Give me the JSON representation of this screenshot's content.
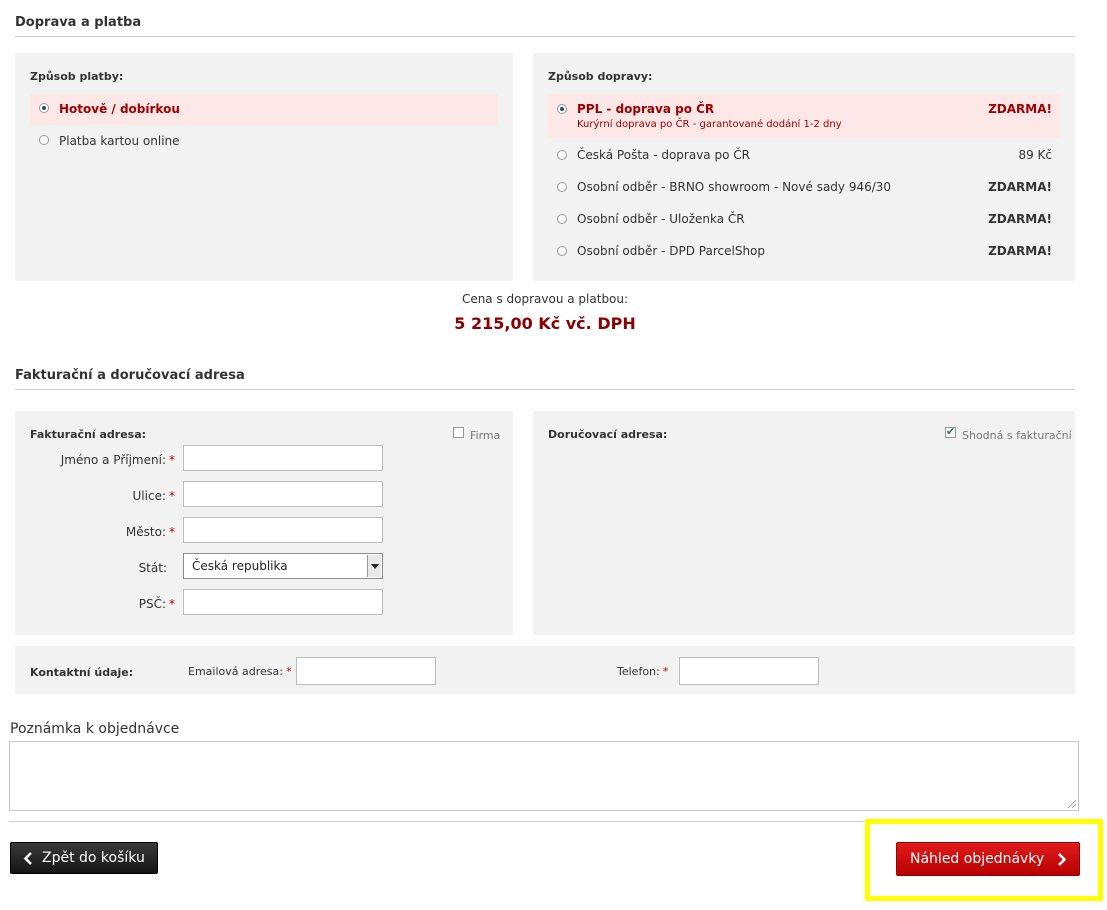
{
  "sections": {
    "shipping_payment_title": "Doprava a platba",
    "address_title": "Fakturační a doručovací adresa"
  },
  "payment": {
    "heading": "Způsob platby:",
    "options": [
      {
        "label": "Hotově / dobírkou",
        "selected": true
      },
      {
        "label": "Platba kartou online",
        "selected": false
      }
    ]
  },
  "shipping": {
    "heading": "Způsob dopravy:",
    "options": [
      {
        "label": "PPL - doprava po ČR",
        "sub": "Kurýrní doprava po ČR - garantované dodání 1-2 dny",
        "price": "ZDARMA!",
        "selected": true
      },
      {
        "label": "Česká Pošta - doprava po ČR",
        "price": "89 Kč",
        "selected": false
      },
      {
        "label": "Osobní odběr - BRNO showroom - Nové sady 946/30",
        "price": "ZDARMA!",
        "selected": false
      },
      {
        "label": "Osobní odběr - Uloženka ČR",
        "price": "ZDARMA!",
        "selected": false
      },
      {
        "label": "Osobní odběr - DPD ParcelShop",
        "price": "ZDARMA!",
        "selected": false
      }
    ]
  },
  "total": {
    "label": "Cena s dopravou a platbou:",
    "value": "5 215,00 Kč vč. DPH"
  },
  "billing": {
    "heading": "Fakturační adresa:",
    "company_label": "Firma",
    "company_checked": false,
    "fields": {
      "name_label": "Jméno a Příjmení:",
      "street_label": "Ulice:",
      "city_label": "Město:",
      "country_label": "Stát:",
      "country_value": "Česká republika",
      "zip_label": "PSČ:"
    },
    "required_mark": "*"
  },
  "delivery": {
    "heading": "Doručovací adresa:",
    "same_label": "Shodná s fakturační",
    "same_checked": true
  },
  "contact": {
    "heading": "Kontaktní údaje:",
    "email_label": "Emailová adresa:",
    "phone_label": "Telefon:"
  },
  "note": {
    "title": "Poznámka k objednávce"
  },
  "buttons": {
    "back_label": "Zpět do košíku",
    "next_label": "Náhled objednávky"
  },
  "colors": {
    "accent_red": "#a00000",
    "button_red": "#d10000",
    "highlight": "#ffff00"
  }
}
